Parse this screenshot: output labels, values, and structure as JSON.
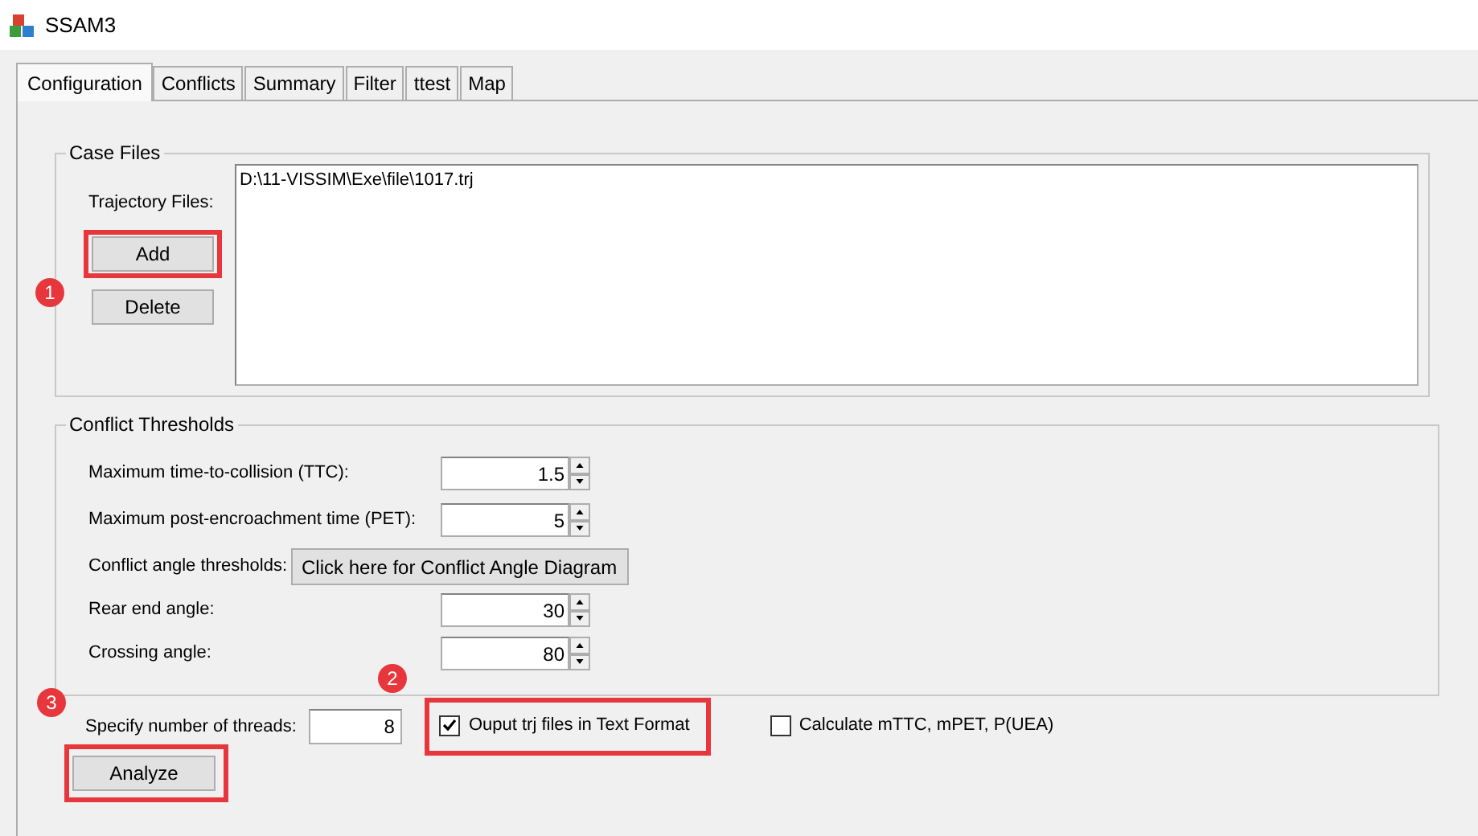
{
  "window": {
    "title": "SSAM3"
  },
  "tabs": [
    {
      "label": "Configuration",
      "selected": true
    },
    {
      "label": "Conflicts",
      "selected": false
    },
    {
      "label": "Summary",
      "selected": false
    },
    {
      "label": "Filter",
      "selected": false
    },
    {
      "label": "ttest",
      "selected": false
    },
    {
      "label": "Map",
      "selected": false
    }
  ],
  "case_files": {
    "title": "Case Files",
    "label": "Trajectory Files:",
    "buttons": [
      {
        "label": "Add",
        "highlighted": true
      },
      {
        "label": "Delete",
        "highlighted": false
      }
    ],
    "files": [
      "D:\\11-VISSIM\\Exe\\file\\1017.trj"
    ]
  },
  "conflict_thresholds": {
    "title": "Conflict Thresholds",
    "rows": [
      {
        "kind": "spin",
        "label": "Maximum time-to-collision (TTC):",
        "value": "1.5"
      },
      {
        "kind": "spin",
        "label": "Maximum post-encroachment time (PET):",
        "value": "5"
      },
      {
        "kind": "button",
        "label": "Conflict angle thresholds:",
        "button": "Click here for Conflict Angle Diagram"
      },
      {
        "kind": "spin",
        "label": "Rear end angle:",
        "value": "30"
      },
      {
        "kind": "spin",
        "label": "Crossing angle:",
        "value": "80"
      }
    ]
  },
  "threads": {
    "label": "Specify number of threads:",
    "value": "8"
  },
  "options": [
    {
      "label": "Ouput trj files in Text Format",
      "checked": true,
      "highlighted": true
    },
    {
      "label": "Calculate mTTC, mPET, P(UEA)",
      "checked": false,
      "highlighted": false
    }
  ],
  "analyze": {
    "label": "Analyze",
    "highlighted": true
  },
  "annotations": [
    {
      "number": "1"
    },
    {
      "number": "2"
    },
    {
      "number": "3"
    }
  ]
}
